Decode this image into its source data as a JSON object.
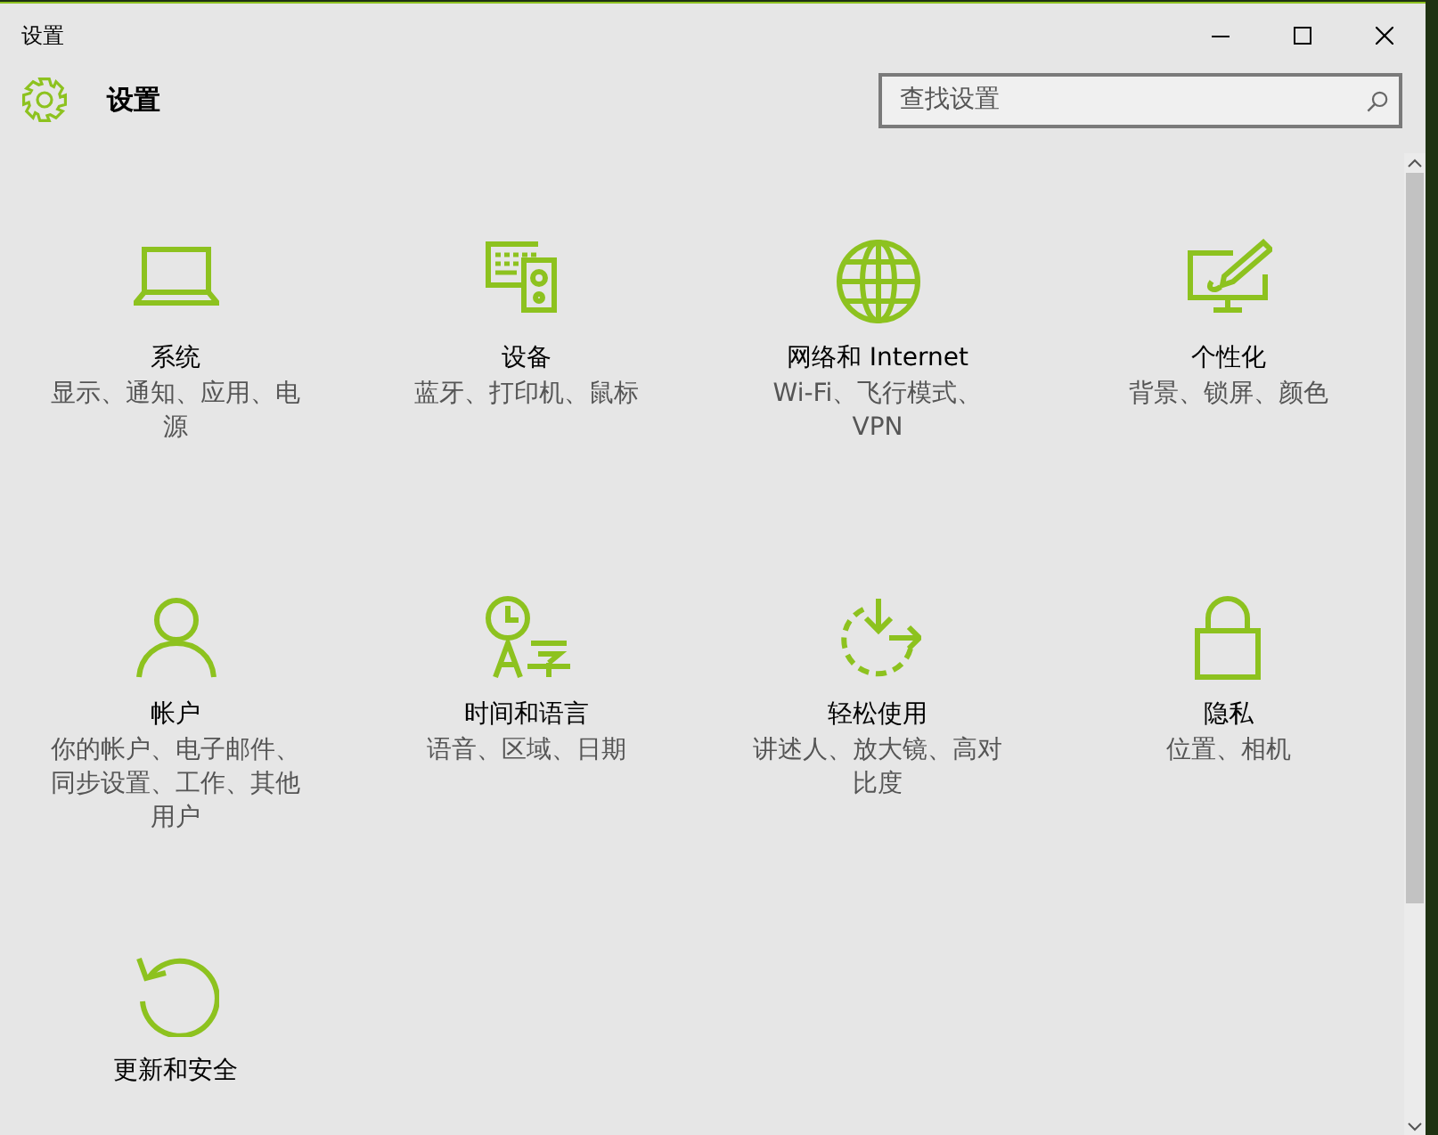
{
  "window": {
    "title": "设置"
  },
  "header": {
    "title": "设置"
  },
  "search": {
    "placeholder": "查找设置"
  },
  "categories": [
    {
      "title": "系统",
      "description": "显示、通知、应用、电源"
    },
    {
      "title": "设备",
      "description": "蓝牙、打印机、鼠标"
    },
    {
      "title": "网络和 Internet",
      "description": "Wi-Fi、飞行模式、VPN"
    },
    {
      "title": "个性化",
      "description": "背景、锁屏、颜色"
    },
    {
      "title": "帐户",
      "description": "你的帐户、电子邮件、同步设置、工作、其他用户"
    },
    {
      "title": "时间和语言",
      "description": "语音、区域、日期"
    },
    {
      "title": "轻松使用",
      "description": "讲述人、放大镜、高对比度"
    },
    {
      "title": "隐私",
      "description": "位置、相机"
    },
    {
      "title": "更新和安全"
    }
  ]
}
